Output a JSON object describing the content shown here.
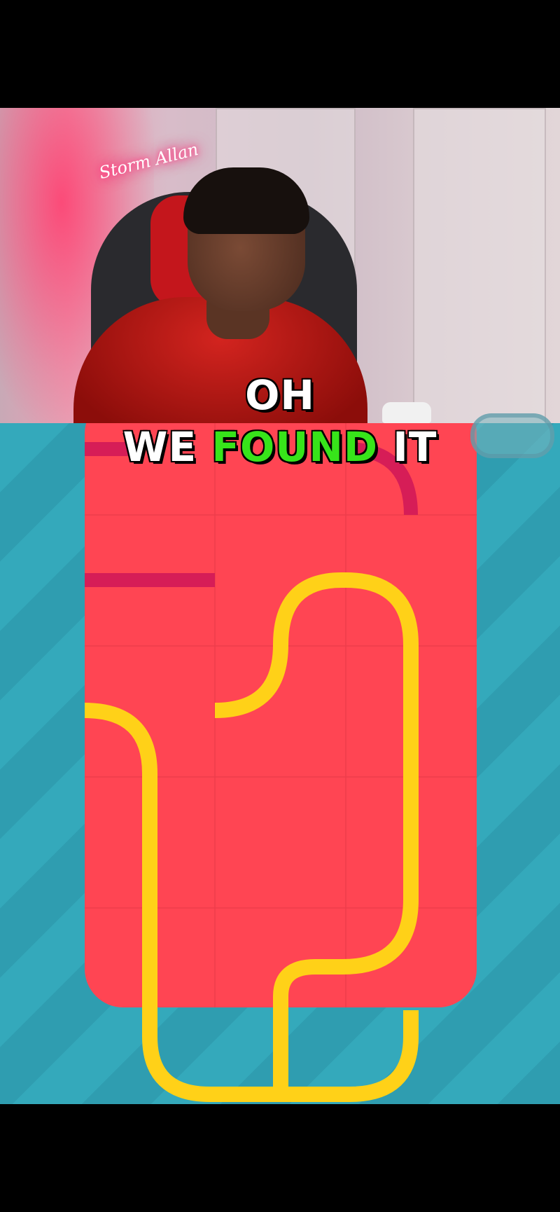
{
  "stream": {
    "overlay_sign": "Storm Allan"
  },
  "caption": {
    "line1": "OH",
    "line2_white_a": "WE",
    "line2_highlight": "FOUND",
    "line2_white_b": "IT",
    "highlight_color": "#37e41a"
  },
  "game": {
    "board_color": "#ff4553",
    "pipe_color": "#ffd118",
    "dark_segment_color": "#d61d57",
    "background_color": "#34a9bb"
  }
}
